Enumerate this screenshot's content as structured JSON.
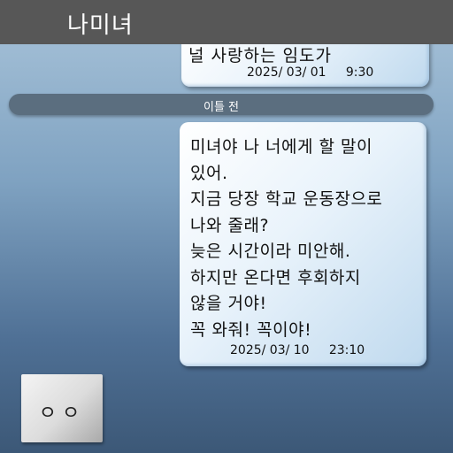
{
  "header": {
    "title": "나미녀"
  },
  "previous_message": {
    "text": "널 사랑하는 임도가",
    "date": "2025/ 03/ 01     9:30"
  },
  "day_divider": {
    "label": "이틀 전"
  },
  "message": {
    "lines": [
      "미녀야 나 너에게 할 말이",
      "있어.",
      "지금 당장 학교 운동장으로",
      "나와 줄래?",
      "늦은 시간이라 미안해.",
      "하지만 온다면 후회하지",
      "않을 거야!",
      "꼭 와줘! 꼭이야!"
    ],
    "date": "2025/ 03/ 10     23:10"
  },
  "avatar": {
    "label": "ㅇㅇ"
  }
}
